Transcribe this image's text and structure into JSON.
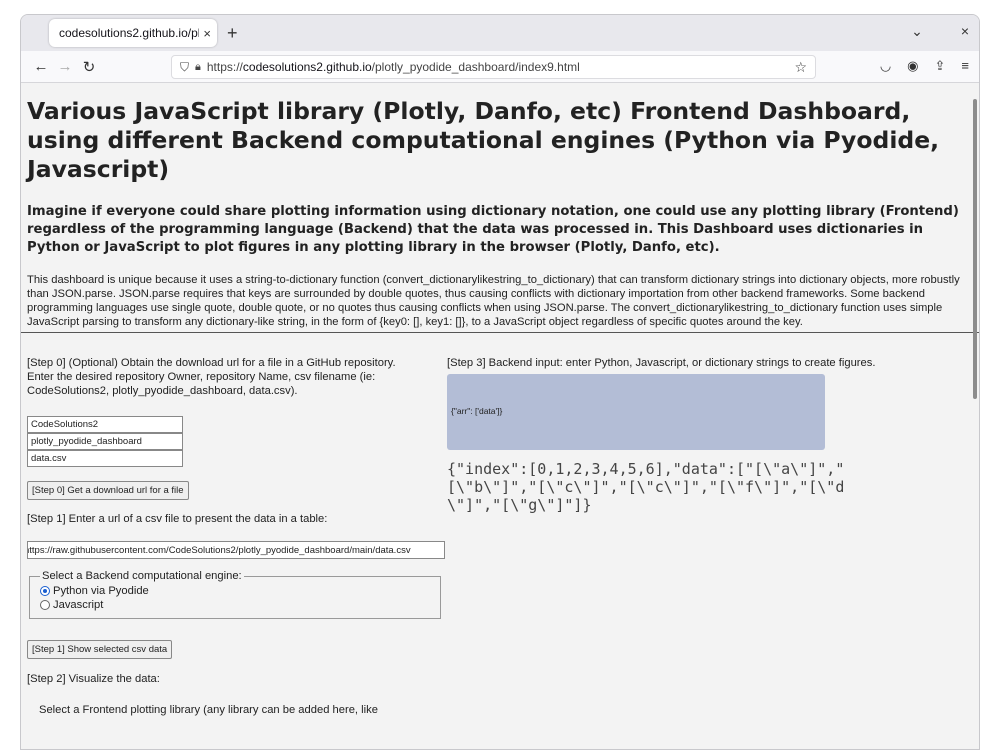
{
  "browser": {
    "tab_title": "codesolutions2.github.io/plo",
    "new_tab": "+",
    "tab_close": "×",
    "window_list": "⌄",
    "window_close": "×",
    "url_prefix": "https://",
    "url_host": "codesolutions2.github.io",
    "url_path": "/plotly_pyodide_dashboard/index9.html"
  },
  "page": {
    "title": "Various JavaScript library (Plotly, Danfo, etc) Frontend Dashboard, using different Backend computational engines (Python via Pyodide, Javascript)",
    "subtitle": "Imagine if everyone could share plotting information using dictionary notation, one could use any plotting library (Frontend) regardless of the programming language (Backend) that the data was processed in. This Dashboard uses dictionaries in Python or JavaScript to plot figures in any plotting library in the browser (Plotly, Danfo, etc).",
    "intro": "This dashboard is unique because it uses a string-to-dictionary function (convert_dictionarylikestring_to_dictionary) that can transform dictionary strings into dictionary objects, more robustly than JSON.parse. JSON.parse requires that keys are surrounded by double quotes, thus causing conflicts with dictionary importation from other backend frameworks. Some backend programming languages use single quote, double quote, or no quotes thus causing conflicts when using JSON.parse. The convert_dictionarylikestring_to_dictionary function uses simple JavaScript parsing to transform any dictionary-like string, in the form of {key0: [], key1: []}, to a JavaScript object regardless of specific quotes around the key."
  },
  "step0": {
    "instructions": "[Step 0] (Optional) Obtain the download url for a file in a GitHub repository. Enter the desired repository Owner, repository Name, csv filename (ie: CodeSolutions2, plotly_pyodide_dashboard, data.csv).",
    "owner_value": "CodeSolutions2",
    "repo_value": "plotly_pyodide_dashboard",
    "file_value": "data.csv",
    "button_label": "[Step 0] Get a download url for a file"
  },
  "step1": {
    "instructions": "[Step 1] Enter a url of a csv file to present the data in a table:",
    "url_value": "https://raw.githubusercontent.com/CodeSolutions2/plotly_pyodide_dashboard/main/data.csv",
    "engine_legend": "Select a Backend computational engine:",
    "engine_options": [
      "Python via Pyodide",
      "Javascript"
    ],
    "engine_selected": "Python via Pyodide",
    "button_label": "[Step 1] Show selected csv data"
  },
  "step2": {
    "instructions": "[Step 2] Visualize the data:",
    "library_text": "Select a Frontend plotting library (any library can be added here, like"
  },
  "step3": {
    "instructions": "[Step 3] Backend input: enter Python, Javascript, or dictionary strings to create figures.",
    "input_value": "{\"arr\": ['data']}",
    "output_text": "{\"index\":[0,1,2,3,4,5,6],\"data\":[\"[\\\"a\\\"]\",\"[\\\"b\\\"]\",\"[\\\"c\\\"]\",\"[\\\"c\\\"]\",\"[\\\"f\\\"]\",\"[\\\"d\\\"]\",\"[\\\"g\\\"]\"]}"
  }
}
